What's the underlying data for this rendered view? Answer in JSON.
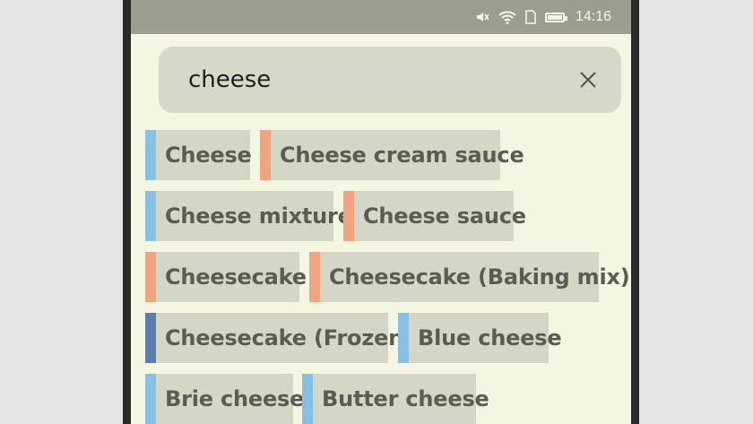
{
  "status_bar": {
    "time": "14:16",
    "icons": [
      "mute-icon",
      "wifi-icon",
      "sim-icon",
      "battery-icon"
    ]
  },
  "search": {
    "value": "cheese",
    "clear_icon": "close-icon"
  },
  "colors": {
    "blue": "#86c0e3",
    "orange": "#f2a481",
    "navy": "#5b7cad"
  },
  "results": [
    {
      "label": "Cheese",
      "color": "blue"
    },
    {
      "label": "Cheese cream sauce",
      "color": "orange"
    },
    {
      "label": "Cheese mixture",
      "color": "blue"
    },
    {
      "label": "Cheese sauce",
      "color": "orange"
    },
    {
      "label": "Cheesecake",
      "color": "orange"
    },
    {
      "label": "Cheesecake (Baking mix)",
      "color": "orange"
    },
    {
      "label": "Cheesecake (Frozen)",
      "color": "navy"
    },
    {
      "label": "Blue cheese",
      "color": "blue"
    },
    {
      "label": "Brie cheese",
      "color": "blue"
    },
    {
      "label": "Butter  cheese",
      "color": "blue"
    }
  ]
}
